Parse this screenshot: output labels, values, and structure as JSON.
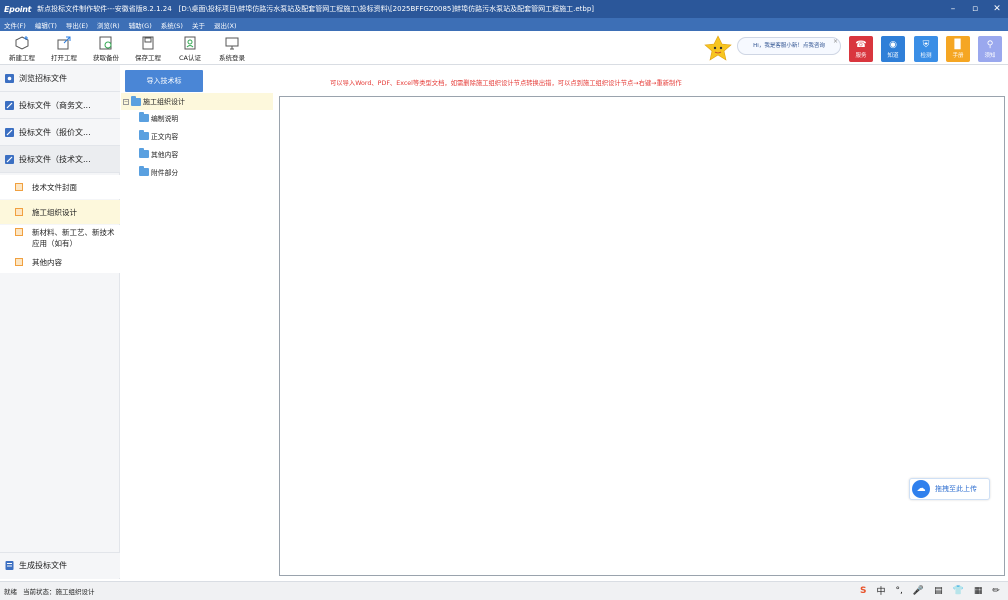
{
  "app": {
    "logo": "Epoint",
    "title": "新点投标文件制作软件---安徽省版8.2.1.24　[D:\\桌面\\投标项目\\蚌埠仿路污水泵站及配套管网工程施工\\投标资料\\[2025BFFGZ0085]蚌埠仿路污水泵站及配套管网工程施工.etbp]"
  },
  "window_controls": {
    "minimize": "–",
    "restore": "▫",
    "close": "✕"
  },
  "menu": [
    "文件(F)",
    "编辑(T)",
    "导出(E)",
    "浏览(R)",
    "辅助(G)",
    "系统(S)",
    "关于",
    "退出(X)"
  ],
  "toolbar": [
    {
      "label": "新建工程",
      "icon": "new-project-icon"
    },
    {
      "label": "打开工程",
      "icon": "open-project-icon"
    },
    {
      "label": "获取备份",
      "icon": "backup-icon"
    },
    {
      "label": "保存工程",
      "icon": "save-icon"
    },
    {
      "label": "CA认证",
      "icon": "ca-icon"
    },
    {
      "label": "系统登录",
      "icon": "login-icon"
    }
  ],
  "assistant": {
    "greeting": "Hi，我是客服小新！点我咨询",
    "close": "×"
  },
  "right_buttons": [
    {
      "label": "服务",
      "color": "#d9363e",
      "icon": "phone-icon"
    },
    {
      "label": "知道",
      "color": "#2f7fd8",
      "icon": "knowledge-icon"
    },
    {
      "label": "检测",
      "color": "#3a8ee6",
      "icon": "shield-icon"
    },
    {
      "label": "手册",
      "color": "#f5a623",
      "icon": "manual-icon"
    },
    {
      "label": "须知",
      "color": "#9aa8ee",
      "icon": "notice-icon"
    }
  ],
  "sidebar": {
    "nav": [
      {
        "label": "浏览招标文件"
      },
      {
        "label": "投标文件（商务文..."
      },
      {
        "label": "投标文件（报价文..."
      },
      {
        "label": "投标文件（技术文..."
      }
    ],
    "sub_items": [
      {
        "label": "技术文件封面"
      },
      {
        "label": "施工组织设计"
      },
      {
        "label": "新材料、新工艺、新技术应用（如有）"
      },
      {
        "label": "其他内容"
      }
    ],
    "generate": "生成投标文件"
  },
  "import_button": "导入技术标",
  "hint": "可以导入Word、PDF、Excel等类型文档，如需删除施工组织设计节点转换出错，可以点到施工组织设计节点→右键→重新制作",
  "tree": {
    "root": "施工组织设计",
    "children": [
      "编制说明",
      "正文内容",
      "其他内容",
      "附件部分"
    ]
  },
  "upload_button": "拖拽至此上传",
  "status": {
    "ready": "就绪",
    "label": "当前状态：",
    "value": "施工组织设计"
  },
  "ime": [
    "S",
    "中",
    "°,",
    "🎤",
    "▤",
    "👕",
    "▦",
    "✏"
  ],
  "colors": {
    "title_bar": "#2b579a",
    "menu_bar": "#3d6fb6",
    "accent": "#4a86d6",
    "hint": "#e53935"
  }
}
